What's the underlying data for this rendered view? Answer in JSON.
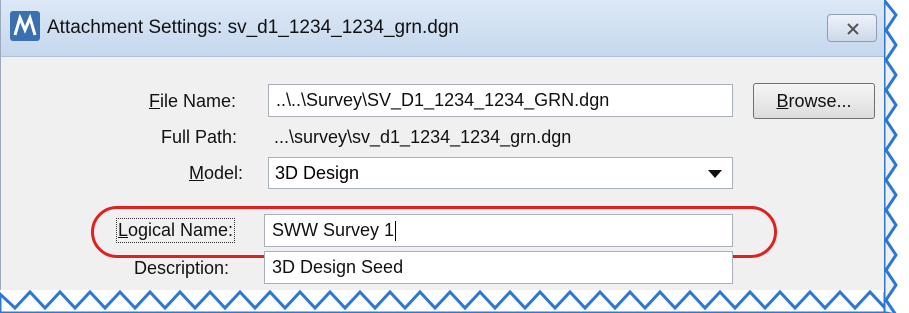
{
  "window": {
    "title": "Attachment Settings: sv_d1_1234_1234_grn.dgn",
    "close_symbol": "✕"
  },
  "form": {
    "file_name": {
      "label_ul": "F",
      "label_rest": "ile Name:",
      "value": "..\\..\\Survey\\SV_D1_1234_1234_GRN.dgn"
    },
    "browse": {
      "label_ul": "B",
      "label_rest": "rowse..."
    },
    "full_path": {
      "label": "Full Path:",
      "value": "...\\survey\\sv_d1_1234_1234_grn.dgn"
    },
    "model": {
      "label_ul": "M",
      "label_rest": "odel:",
      "value": "3D Design"
    },
    "logical_name": {
      "label_ul": "L",
      "label_rest": "ogical Name:",
      "value": "SWW Survey 1"
    },
    "description": {
      "label": "Description:",
      "value": "3D Design Seed"
    }
  },
  "colors": {
    "highlight_ellipse": "#e0211f",
    "torn_edge": "#2b78d6",
    "titlebar": "#c6d8ee"
  },
  "icons": [
    "microstation-app-icon",
    "close-icon",
    "dropdown-arrow-icon"
  ]
}
